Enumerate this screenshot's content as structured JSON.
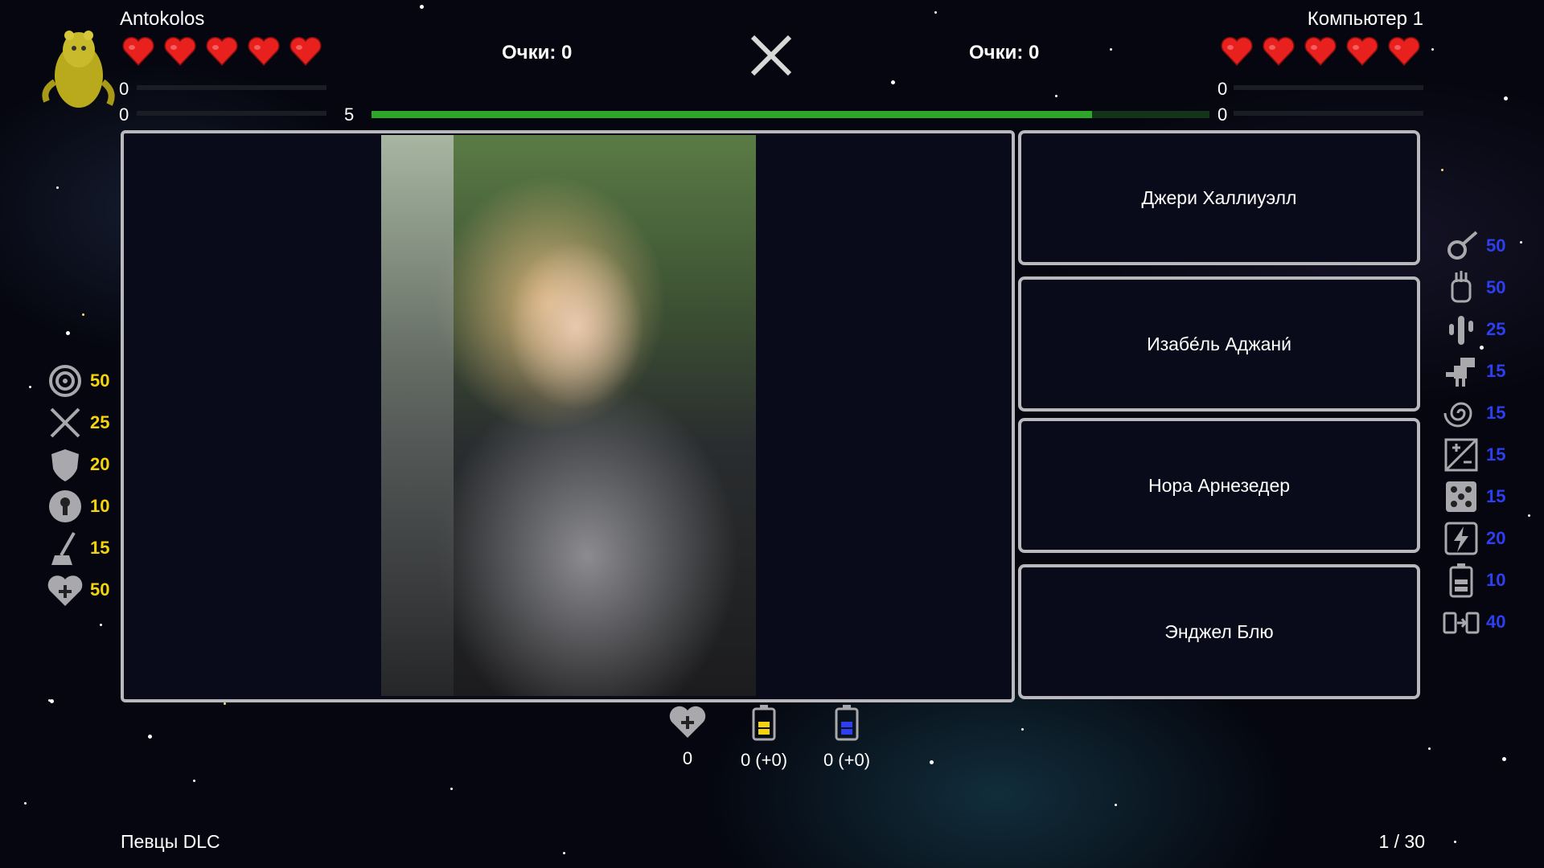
{
  "player1": {
    "name": "Antokolos",
    "score": "Очки: 0",
    "lives": 5,
    "bar1_value": "0",
    "bar2_value": "0"
  },
  "player2": {
    "name": "Компьютер 1",
    "score": "Очки: 0",
    "lives": 5,
    "bar1_value": "0",
    "bar2_value": "0"
  },
  "timer": {
    "label": "5",
    "fraction": 0.86
  },
  "answers": [
    "Джери Халлиуэлл",
    "Изабе́ль Аджани́",
    "Нора Арнезедер",
    "Энджел Блю"
  ],
  "boosts_left": [
    {
      "icon": "target-icon",
      "value": "50"
    },
    {
      "icon": "crossed-tools-icon",
      "value": "25"
    },
    {
      "icon": "shield-icon",
      "value": "20"
    },
    {
      "icon": "keyhole-icon",
      "value": "10"
    },
    {
      "icon": "broom-icon",
      "value": "15"
    },
    {
      "icon": "heart-plus-icon",
      "value": "50"
    }
  ],
  "boosts_right": [
    {
      "icon": "meteor-icon",
      "value": "50"
    },
    {
      "icon": "hand-icon",
      "value": "50"
    },
    {
      "icon": "cactus-icon",
      "value": "25"
    },
    {
      "icon": "dinosaur-icon",
      "value": "15"
    },
    {
      "icon": "spiral-icon",
      "value": "15"
    },
    {
      "icon": "plus-minus-icon",
      "value": "15"
    },
    {
      "icon": "dice-icon",
      "value": "15"
    },
    {
      "icon": "lightning-icon",
      "value": "20"
    },
    {
      "icon": "battery-icon",
      "value": "10"
    },
    {
      "icon": "battery-transfer-icon",
      "value": "40"
    }
  ],
  "inventory": [
    {
      "icon": "heart-plus-icon",
      "label": "0"
    },
    {
      "icon": "yellow-battery-icon",
      "label": "0 (+0)"
    },
    {
      "icon": "blue-battery-icon",
      "label": "0 (+0)"
    }
  ],
  "footer": {
    "pack": "Певцы DLC",
    "progress": "1 / 30"
  },
  "colors": {
    "heart": "#e8201e",
    "timer": "#2ea62a",
    "boost_yellow": "#f5d40f",
    "boost_blue": "#2d3ff0"
  }
}
